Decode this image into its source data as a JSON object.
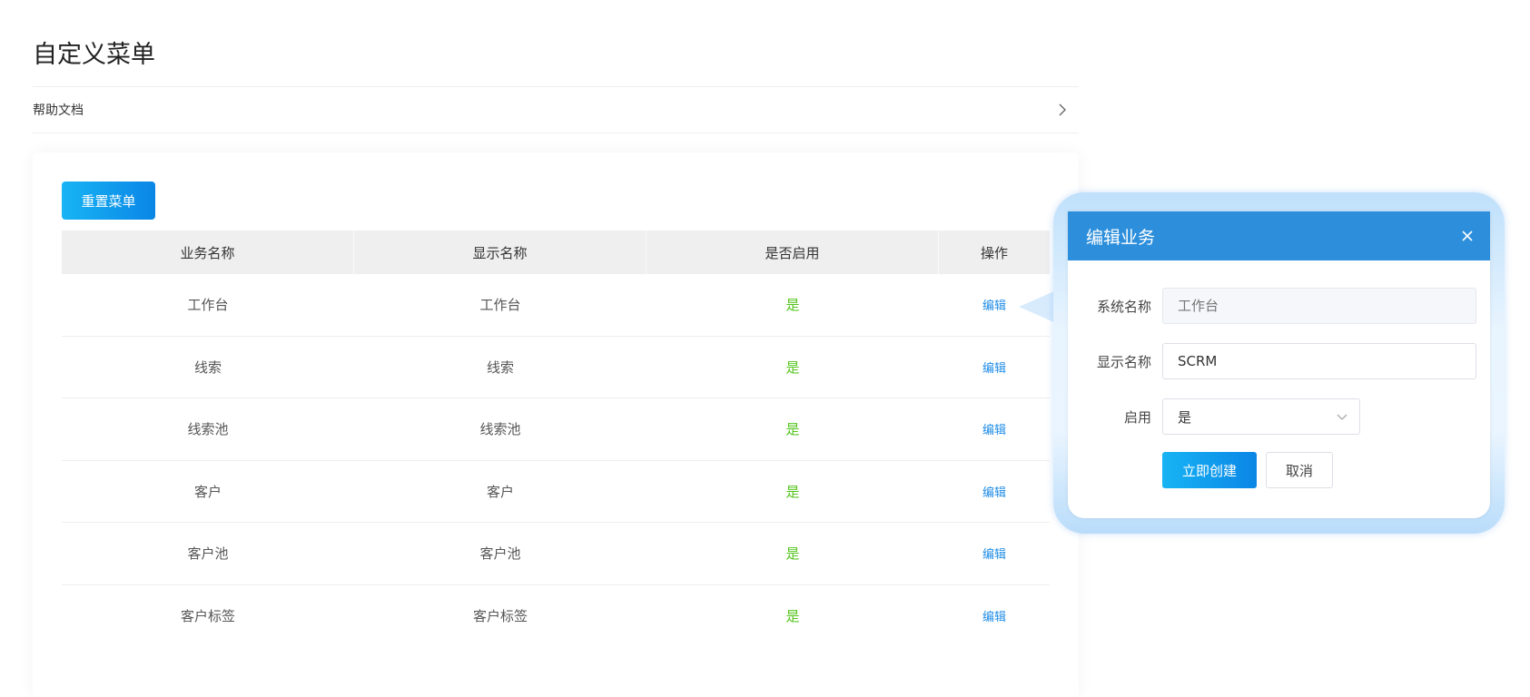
{
  "page": {
    "title": "自定义菜单"
  },
  "help": {
    "label": "帮助文档",
    "chevron_icon": "chevron-right-icon"
  },
  "toolbar": {
    "reset_label": "重置菜单"
  },
  "table": {
    "columns": [
      "业务名称",
      "显示名称",
      "是否启用",
      "操作"
    ],
    "rows": [
      {
        "business": "工作台",
        "display": "工作台",
        "enabled": "是",
        "action": "编辑"
      },
      {
        "business": "线索",
        "display": "线索",
        "enabled": "是",
        "action": "编辑"
      },
      {
        "business": "线索池",
        "display": "线索池",
        "enabled": "是",
        "action": "编辑"
      },
      {
        "business": "客户",
        "display": "客户",
        "enabled": "是",
        "action": "编辑"
      },
      {
        "business": "客户池",
        "display": "客户池",
        "enabled": "是",
        "action": "编辑"
      },
      {
        "business": "客户标签",
        "display": "客户标签",
        "enabled": "是",
        "action": "编辑"
      }
    ]
  },
  "dialog": {
    "title": "编辑业务",
    "close_icon": "close-icon",
    "system_name_label": "系统名称",
    "system_name_placeholder": "工作台",
    "display_name_label": "显示名称",
    "display_name_value": "SCRM",
    "enable_label": "启用",
    "enable_value": "是",
    "submit_label": "立即创建",
    "cancel_label": "取消"
  },
  "colors": {
    "primary": "#0a86e6",
    "header_blue": "#2d8fdc",
    "enabled_green": "#52c41a",
    "link_blue": "#1e8ce6"
  }
}
